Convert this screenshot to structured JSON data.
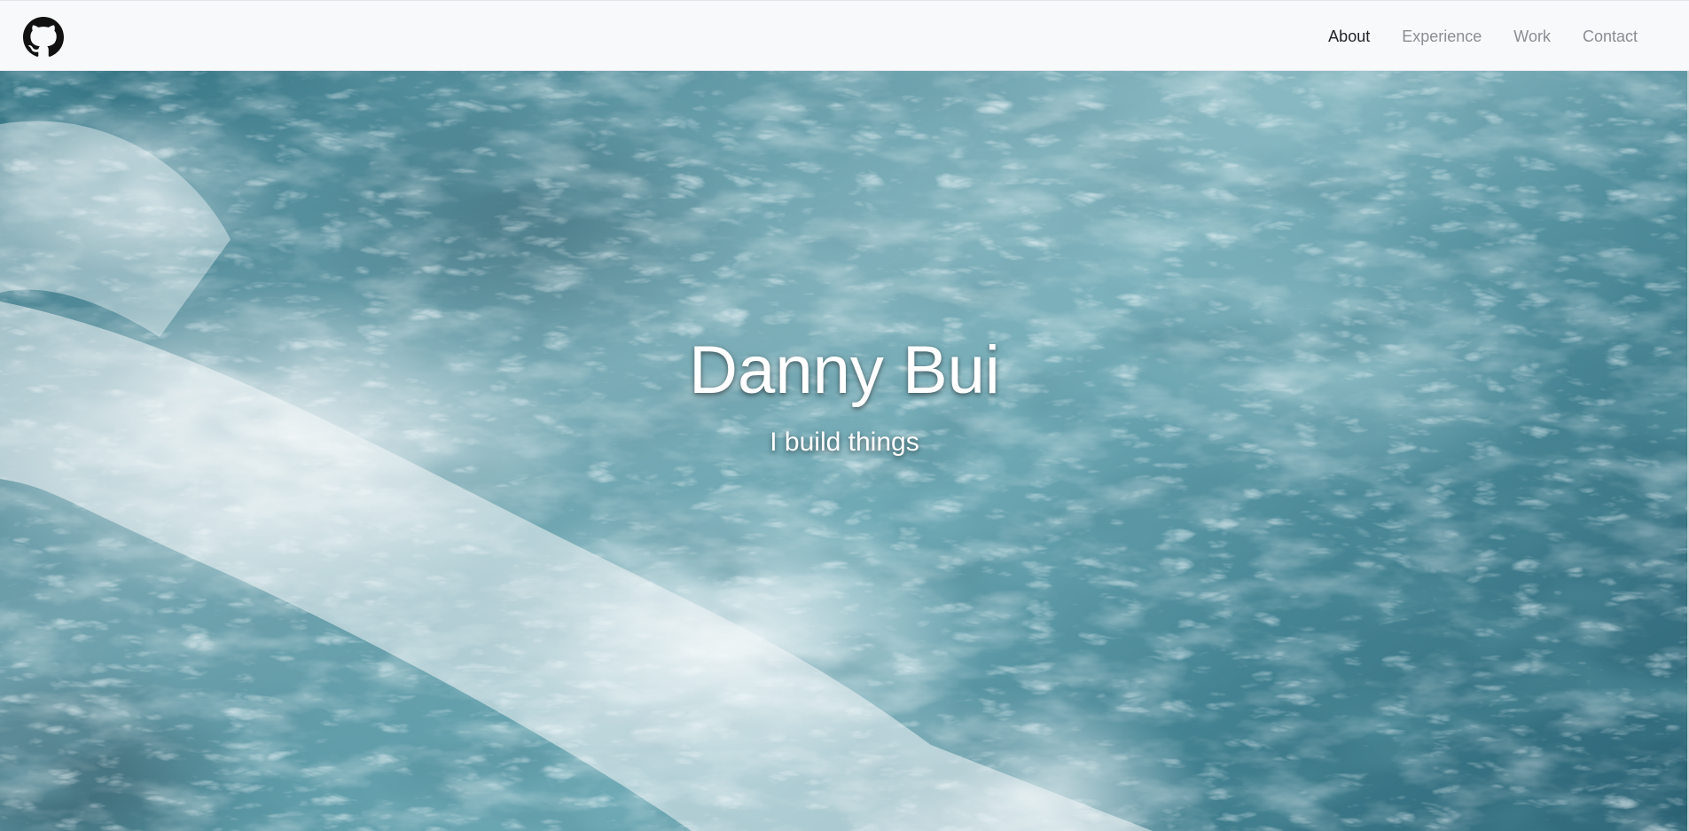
{
  "navbar": {
    "brand_icon": "github-icon",
    "links": [
      {
        "label": "About",
        "active": true
      },
      {
        "label": "Experience",
        "active": false
      },
      {
        "label": "Work",
        "active": false
      },
      {
        "label": "Contact",
        "active": false
      }
    ]
  },
  "hero": {
    "title": "Danny Bui",
    "subtitle": "I build things",
    "background": "ocean-waves-aerial-photo"
  },
  "colors": {
    "navbar_bg": "#f8f9fa",
    "nav_active": "#212529",
    "nav_inactive": "#8a8d91",
    "hero_text": "#ffffff",
    "ocean_dark": "#2a6274",
    "ocean_mid": "#4c8e9c",
    "foam": "#f0f6f8"
  }
}
